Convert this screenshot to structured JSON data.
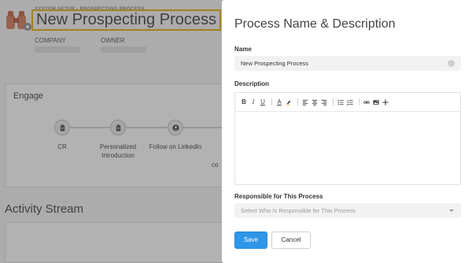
{
  "background": {
    "breadcrumb": "SYSTEM SETUP - PROSPECTING PROCESS",
    "title": "New Prospecting Process",
    "company_label": "COMPANY",
    "owner_label": "OWNER",
    "engage": {
      "title": "Engage",
      "steps": [
        {
          "label": "CR",
          "icon": "clipboard-icon"
        },
        {
          "label": "Personalized Introduction",
          "icon": "clipboard-icon"
        },
        {
          "label": "Follow on LinkedIn",
          "icon": "user-icon"
        },
        {
          "label": "co",
          "icon": ""
        }
      ]
    },
    "activity_title": "Activity Stream"
  },
  "modal": {
    "title": "Process Name & Description",
    "name_label": "Name",
    "name_value": "New Prospecting Process",
    "description_label": "Description",
    "responsible_label": "Responsible for This Process",
    "responsible_placeholder": "Select Who Is Responsible for This Process",
    "save_label": "Save",
    "cancel_label": "Cancel",
    "toolbar": {
      "bold": "B",
      "italic": "I",
      "underline": "U",
      "font_color": "A"
    }
  },
  "colors": {
    "accent": "#2f96e8",
    "title_highlight": "#e8b820"
  }
}
